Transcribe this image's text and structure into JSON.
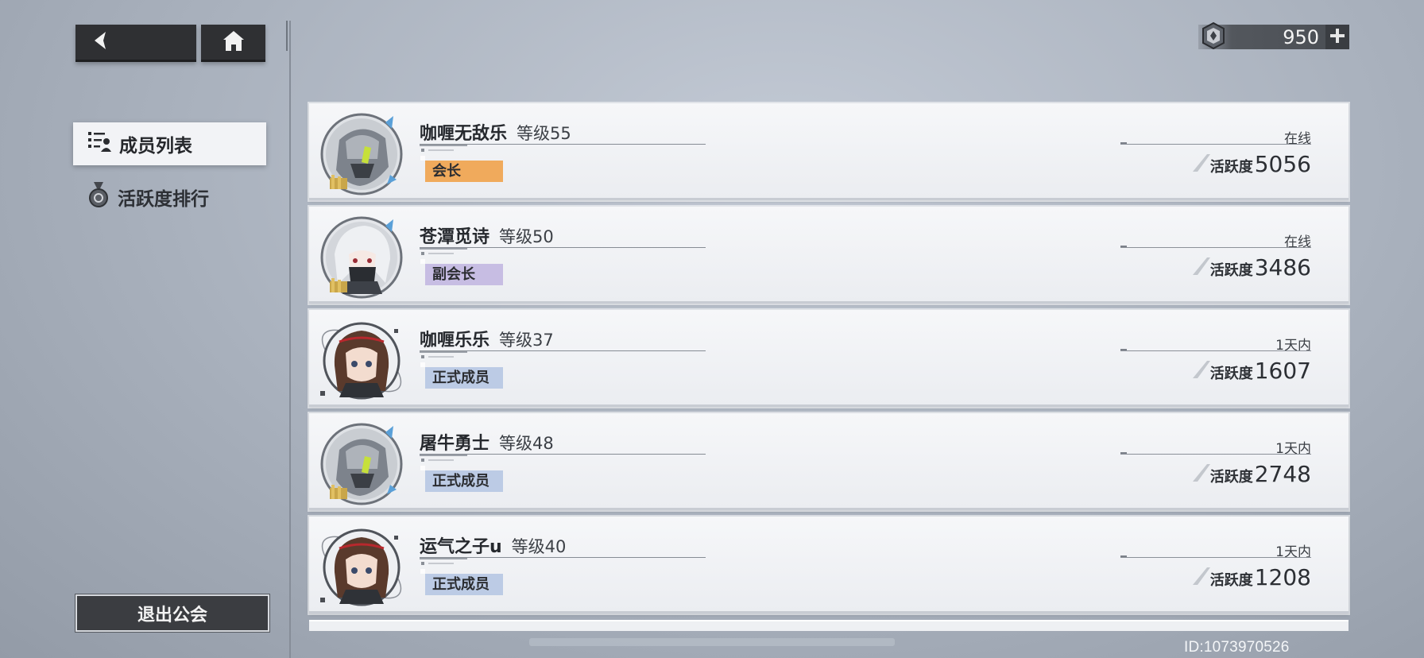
{
  "header": {
    "back_icon": "arrow-left-icon",
    "home_icon": "home-icon",
    "currency": {
      "icon": "guild-coin-icon",
      "value": "950",
      "plus": "+"
    }
  },
  "sidebar": {
    "items": [
      {
        "label": "成员列表",
        "icon": "member-list-icon",
        "active": true
      },
      {
        "label": "活跃度排行",
        "icon": "medal-icon",
        "active": false
      }
    ],
    "exit_label": "退出公会"
  },
  "members": [
    {
      "name": "咖喱无敌乐",
      "level": "等级55",
      "role": "会长",
      "role_color": "#f0aa5c",
      "status": "在线",
      "activity_label": "活跃度",
      "activity": "5056",
      "avatar": "mech-helmet"
    },
    {
      "name": "苍潭觅诗",
      "level": "等级50",
      "role": "副会长",
      "role_color": "#c7bde3",
      "status": "在线",
      "activity_label": "活跃度",
      "activity": "3486",
      "avatar": "white-hair"
    },
    {
      "name": "咖喱乐乐",
      "level": "等级37",
      "role": "正式成员",
      "role_color": "#bccbe5",
      "status": "1天内",
      "activity_label": "活跃度",
      "activity": "1607",
      "avatar": "brown-hair"
    },
    {
      "name": "屠牛勇士",
      "level": "等级48",
      "role": "正式成员",
      "role_color": "#bccbe5",
      "status": "1天内",
      "activity_label": "活跃度",
      "activity": "2748",
      "avatar": "mech-helmet"
    },
    {
      "name": "运气之子u",
      "level": "等级40",
      "role": "正式成员",
      "role_color": "#bccbe5",
      "status": "1天内",
      "activity_label": "活跃度",
      "activity": "1208",
      "avatar": "brown-hair"
    }
  ],
  "footer": {
    "player_id": "ID:1073970526"
  }
}
